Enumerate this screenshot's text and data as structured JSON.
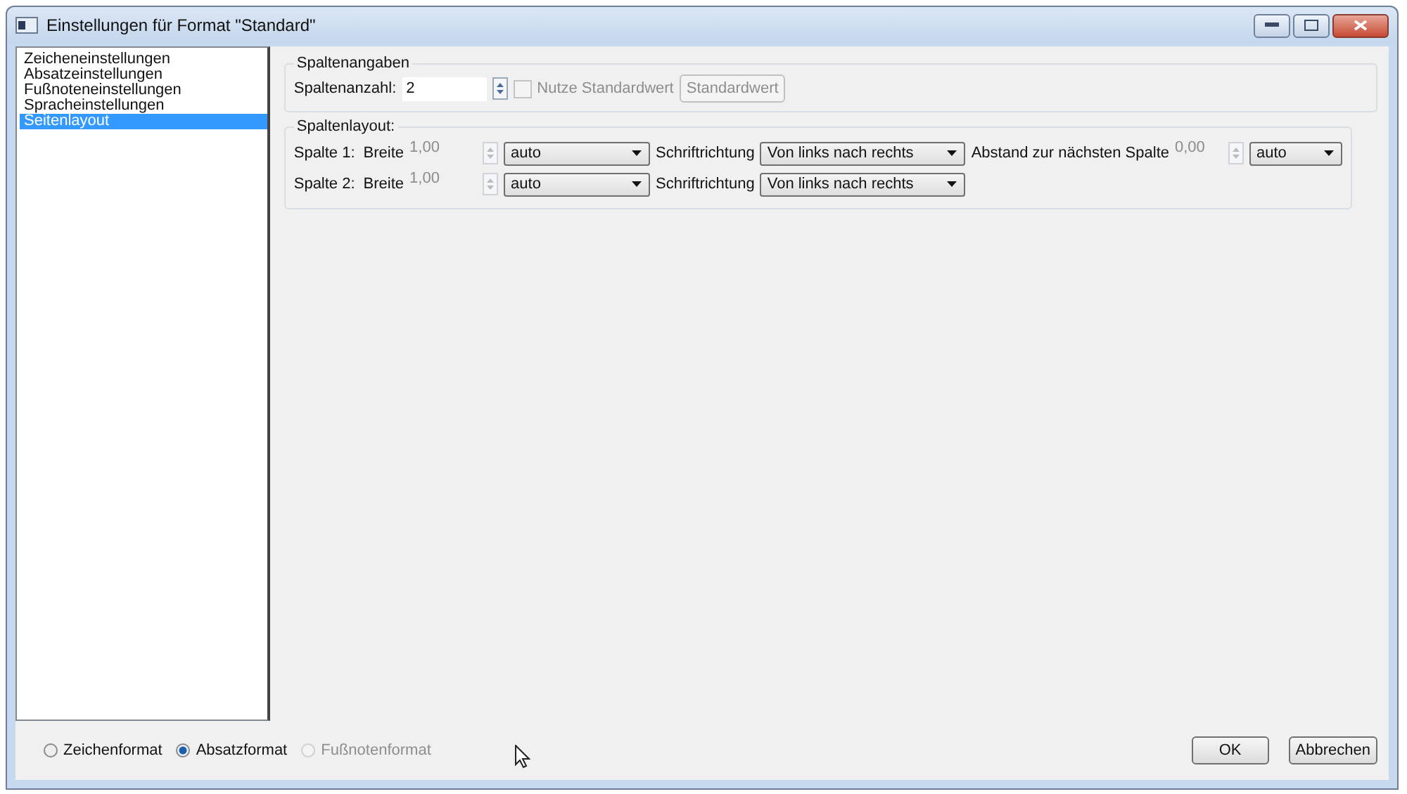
{
  "window": {
    "title": "Einstellungen für Format \"Standard\""
  },
  "sidebar": {
    "items": [
      {
        "label": "Zeicheneinstellungen",
        "selected": false
      },
      {
        "label": "Absatzeinstellungen",
        "selected": false
      },
      {
        "label": "Fußnoteneinstellungen",
        "selected": false
      },
      {
        "label": "Spracheinstellungen",
        "selected": false
      },
      {
        "label": "Seitenlayout",
        "selected": true
      }
    ]
  },
  "column_settings": {
    "title": "Spaltenangaben",
    "count_label": "Spaltenanzahl:",
    "count_value": "2",
    "use_default": {
      "label": "Nutze Standardwert",
      "checked": false,
      "disabled": true
    },
    "default_button": {
      "label": "Standardwert",
      "disabled": true
    }
  },
  "column_layout": {
    "title": "Spaltenlayout:",
    "rows": [
      {
        "label": "Spalte 1:",
        "width_label": "Breite",
        "width_value": "1,00",
        "width_mode": "auto",
        "direction_label": "Schriftrichtung",
        "direction": "Von links nach rechts",
        "spacing": {
          "label": "Abstand zur nächsten Spalte",
          "value": "0,00",
          "mode": "auto"
        }
      },
      {
        "label": "Spalte 2:",
        "width_label": "Breite",
        "width_value": "1,00",
        "width_mode": "auto",
        "direction_label": "Schriftrichtung",
        "direction": "Von links nach rechts"
      }
    ]
  },
  "format_options": [
    {
      "label": "Zeichenformat",
      "selected": false,
      "disabled": false
    },
    {
      "label": "Absatzformat",
      "selected": true,
      "disabled": false
    },
    {
      "label": "Fußnotenformat",
      "selected": false,
      "disabled": true
    }
  ],
  "buttons": [
    {
      "label": "OK"
    },
    {
      "label": "Abbrechen"
    }
  ]
}
